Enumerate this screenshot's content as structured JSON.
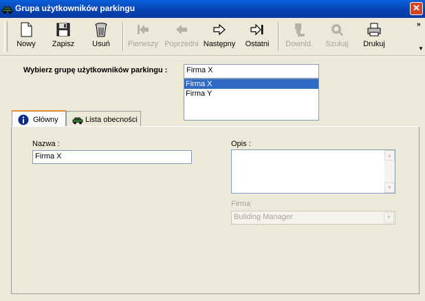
{
  "window": {
    "title": "Grupa użytkowników parkingu",
    "close": "✕"
  },
  "toolbar": {
    "buttons": [
      {
        "label": "Nowy",
        "icon": "new-document-icon",
        "enabled": true
      },
      {
        "label": "Zapisz",
        "icon": "floppy-disk-icon",
        "enabled": true
      },
      {
        "label": "Usuń",
        "icon": "trash-can-icon",
        "enabled": true
      },
      {
        "label": "Pierwszy",
        "icon": "first-record-icon",
        "enabled": false
      },
      {
        "label": "Poprzedni",
        "icon": "previous-record-icon",
        "enabled": false
      },
      {
        "label": "Następny",
        "icon": "next-record-icon",
        "enabled": true
      },
      {
        "label": "Ostatni",
        "icon": "last-record-icon",
        "enabled": true
      },
      {
        "label": "Downld.",
        "icon": "download-icon",
        "enabled": false
      },
      {
        "label": "Szukaj",
        "icon": "search-icon",
        "enabled": false
      },
      {
        "label": "Drukuj",
        "icon": "printer-icon",
        "enabled": true
      }
    ],
    "overflow": "»",
    "dropdown": "▼"
  },
  "group_select": {
    "label": "Wybierz grupę użytkowników parkingu :",
    "value": "Firma X",
    "options": [
      "Firma X",
      "Firma Y"
    ],
    "selected_index": 0
  },
  "tabs": [
    {
      "label": "Główny",
      "icon": "info-icon",
      "active": true
    },
    {
      "label": "Lista obecności",
      "icon": "car-icon",
      "active": false
    }
  ],
  "form": {
    "name_label": "Nazwa :",
    "name_value": "Firma X",
    "desc_label": "Opis :",
    "desc_value": "",
    "company_label": "Firma",
    "company_value": "Building Manager"
  },
  "colors": {
    "titlebar": "#0842b0",
    "selection": "#316ac5",
    "tab_accent": "#e68b2c"
  }
}
